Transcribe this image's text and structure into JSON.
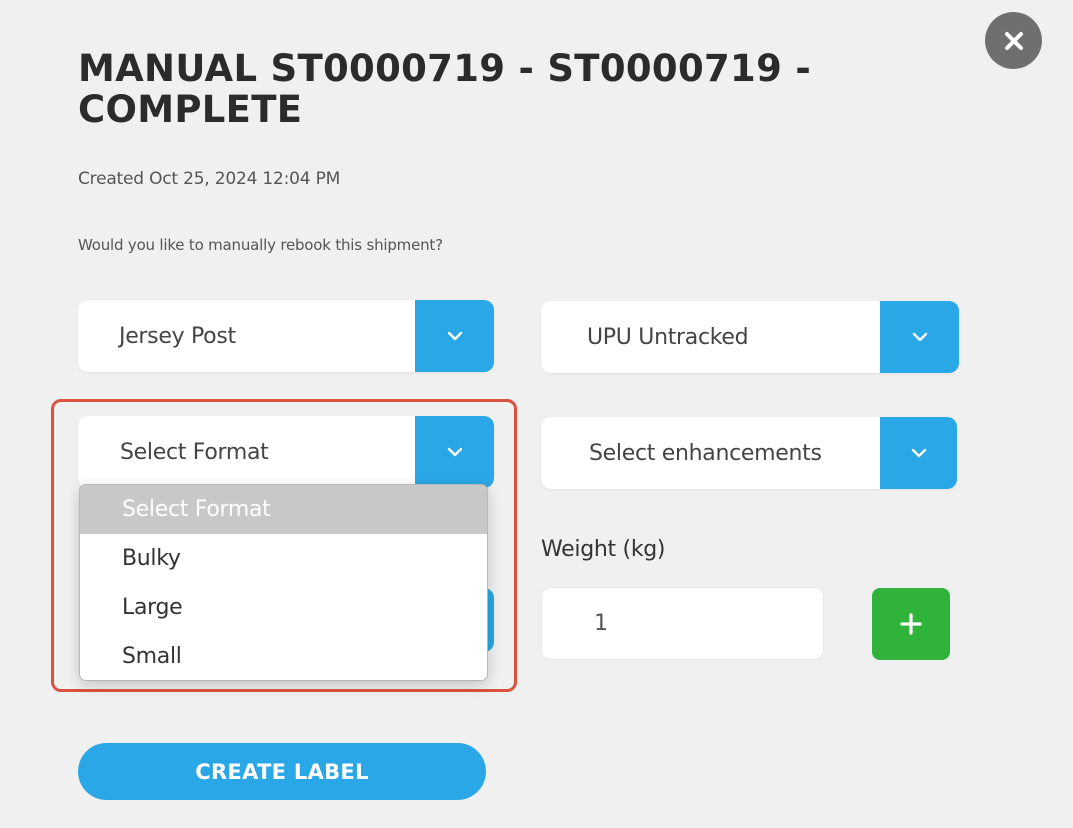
{
  "modal": {
    "title": "MANUAL ST0000719 - ST0000719 - COMPLETE",
    "created": "Created Oct 25, 2024 12:04 PM",
    "question": "Would you like to manually rebook this shipment?",
    "close_icon": "close-icon"
  },
  "form": {
    "carrier": {
      "value": "Jersey Post"
    },
    "service": {
      "value": "UPU Untracked"
    },
    "format": {
      "value": "Select Format",
      "options": [
        "Select Format",
        "Bulky",
        "Large",
        "Small"
      ],
      "selected_index": 0
    },
    "enhancements": {
      "value": "Select enhancements"
    },
    "weight": {
      "label": "Weight (kg)",
      "value": "1"
    },
    "add_icon": "plus-icon",
    "create_label": "CREATE LABEL"
  },
  "colors": {
    "accent": "#2aa7e6",
    "add_button": "#2fb33a",
    "highlight": "#d9533f",
    "close_button": "#6f6f6f"
  }
}
